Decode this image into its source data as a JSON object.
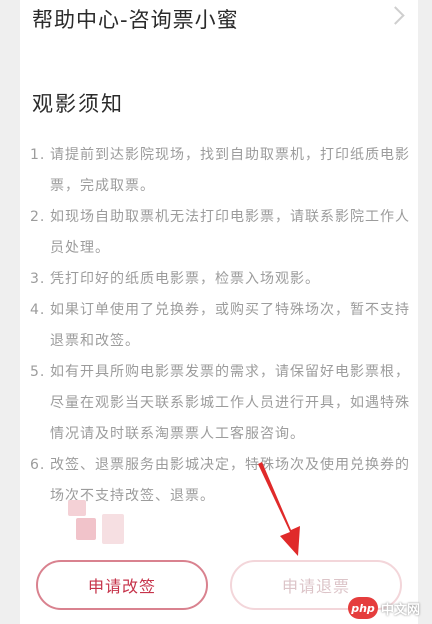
{
  "help_row": {
    "title": "帮助中心-咨询票小蜜",
    "chevron_icon": "chevron-right-icon"
  },
  "section": {
    "title": "观影须知"
  },
  "notices": [
    {
      "num": "1.",
      "text": "请提前到达影院现场，找到自助取票机，打印纸质电影票，完成取票。"
    },
    {
      "num": "2.",
      "text": "如现场自助取票机无法打印电影票，请联系影院工作人员处理。"
    },
    {
      "num": "3.",
      "text": "凭打印好的纸质电影票，检票入场观影。"
    },
    {
      "num": "4.",
      "text": "如果订单使用了兑换券，或购买了特殊场次，暂不支持退票和改签。"
    },
    {
      "num": "5.",
      "text": "如有开具所购电影票发票的需求，请保留好电影票根，尽量在观影当天联系影城工作人员进行开具，如遇特殊情况请及时联系淘票票人工客服咨询。"
    },
    {
      "num": "6.",
      "text": "改签、退票服务由影城决定，特殊场次及使用兑换券的场次不支持改签、退票。"
    }
  ],
  "buttons": {
    "change": "申请改签",
    "refund": "申请退票"
  },
  "annotation": {
    "arrow_icon": "red-arrow-icon",
    "color": "#e02a2a"
  },
  "watermark": {
    "logo": "php",
    "text": "中文网"
  }
}
